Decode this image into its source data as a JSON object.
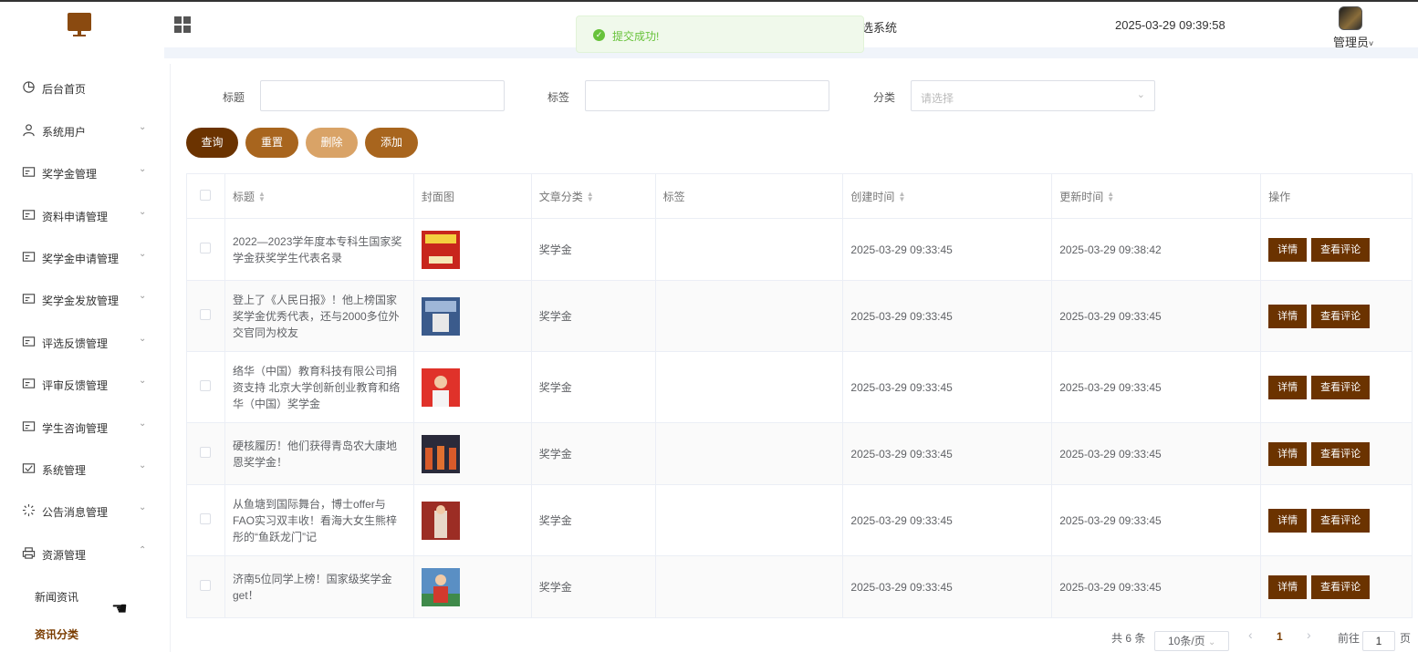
{
  "header": {
    "system_title": "选系统",
    "clock": "2025-03-29 09:39:58",
    "user_name": "管理员",
    "user_caret": "˅"
  },
  "toast": {
    "message": "提交成功!",
    "icon": "check-icon"
  },
  "sidebar": {
    "items": [
      {
        "label": "后台首页",
        "icon": "pie-chart-icon",
        "arrow": ""
      },
      {
        "label": "系统用户",
        "icon": "user-icon",
        "arrow": "⌄"
      },
      {
        "label": "奖学金管理",
        "icon": "card-icon",
        "arrow": "⌄"
      },
      {
        "label": "资料申请管理",
        "icon": "card-icon",
        "arrow": "⌄"
      },
      {
        "label": "奖学金申请管理",
        "icon": "card-icon",
        "arrow": "⌄"
      },
      {
        "label": "奖学金发放管理",
        "icon": "card-icon",
        "arrow": "⌄"
      },
      {
        "label": "评选反馈管理",
        "icon": "card-icon",
        "arrow": "⌄"
      },
      {
        "label": "评审反馈管理",
        "icon": "card-icon",
        "arrow": "⌄"
      },
      {
        "label": "学生咨询管理",
        "icon": "card-icon",
        "arrow": "⌄"
      },
      {
        "label": "系统管理",
        "icon": "settings-card-icon",
        "arrow": "⌄"
      },
      {
        "label": "公告消息管理",
        "icon": "loading-icon",
        "arrow": "⌄"
      },
      {
        "label": "资源管理",
        "icon": "printer-icon",
        "arrow": "⌃"
      }
    ],
    "sub_items": [
      {
        "label": "新闻资讯"
      },
      {
        "label": "资讯分类"
      }
    ]
  },
  "search": {
    "title_label": "标题",
    "title_value": "",
    "tag_label": "标签",
    "tag_value": "",
    "category_label": "分类",
    "category_placeholder": "请选择"
  },
  "buttons": {
    "query": "查询",
    "reset": "重置",
    "delete": "删除",
    "add": "添加"
  },
  "colors": {
    "query": "#6b3300",
    "reset": "#a8651e",
    "delete": "#d9a367",
    "add": "#a8651e",
    "accent": "#6b3300",
    "toast_text": "#67c23a"
  },
  "table": {
    "headers": {
      "title": "标题",
      "cover": "封面图",
      "category": "文章分类",
      "tags": "标签",
      "created": "创建时间",
      "updated": "更新时间",
      "actions": "操作"
    },
    "rows": [
      {
        "title": "2022—2023学年度本专科生国家奖学金获奖学生代表名录",
        "category": "奖学金",
        "tags": "",
        "created": "2025-03-29 09:33:45",
        "updated": "2025-03-29 09:38:42",
        "thumb": "red-poster"
      },
      {
        "title": "登上了《人民日报》！他上榜国家奖学金优秀代表，还与2000多位外交官同为校友",
        "category": "奖学金",
        "tags": "",
        "created": "2025-03-29 09:33:45",
        "updated": "2025-03-29 09:33:45",
        "thumb": "blue-hall"
      },
      {
        "title": "络华（中国）教育科技有限公司捐资支持 北京大学创新创业教育和络华（中国）奖学金",
        "category": "奖学金",
        "tags": "",
        "created": "2025-03-29 09:33:45",
        "updated": "2025-03-29 09:33:45",
        "thumb": "red-person"
      },
      {
        "title": "硬核履历！他们获得青岛农大康地恩奖学金！",
        "category": "奖学金",
        "tags": "",
        "created": "2025-03-29 09:33:45",
        "updated": "2025-03-29 09:33:45",
        "thumb": "group-photo"
      },
      {
        "title": "从鱼塘到国际舞台，博士offer与FAO实习双丰收！看海大女生熊梓彤的“鱼跃龙门”记",
        "category": "奖学金",
        "tags": "",
        "created": "2025-03-29 09:33:45",
        "updated": "2025-03-29 09:33:45",
        "thumb": "stage-photo"
      },
      {
        "title": "济南5位同学上榜！国家级奖学金get！",
        "category": "奖学金",
        "tags": "",
        "created": "2025-03-29 09:33:45",
        "updated": "2025-03-29 09:33:45",
        "thumb": "student-photo"
      }
    ],
    "detail_label": "详情",
    "comments_label": "查看评论"
  },
  "pagination": {
    "total": "共 6 条",
    "page_size": "10条/页",
    "prev": "‹",
    "current": "1",
    "next": "›",
    "goto_prefix": "前往",
    "goto_value": "1",
    "goto_suffix": "页"
  }
}
